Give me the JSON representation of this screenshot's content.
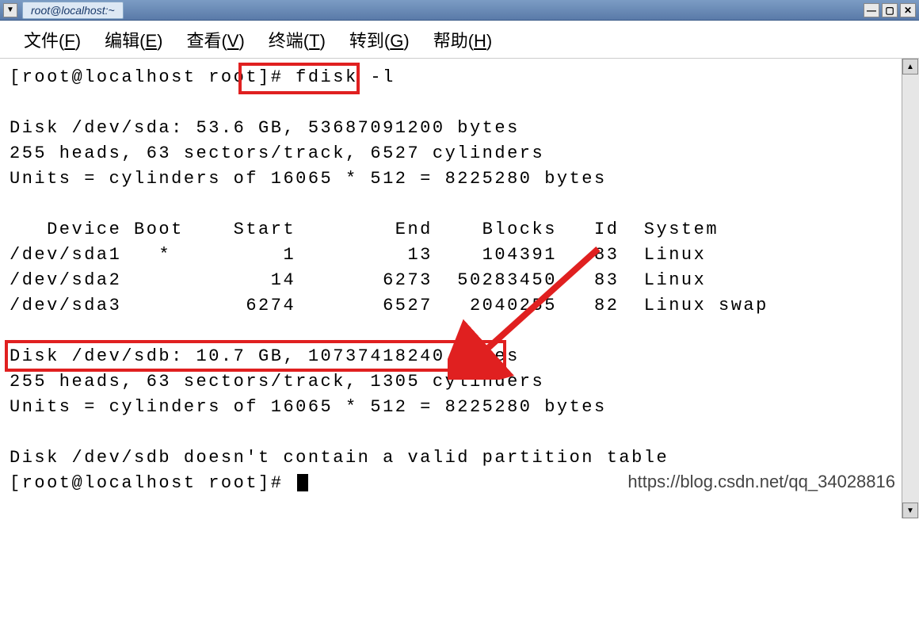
{
  "titlebar": {
    "title": "root@localhost:~"
  },
  "menu": {
    "file": "文件(F)",
    "edit": "编辑(E)",
    "view": "查看(V)",
    "terminal": "终端(T)",
    "go": "转到(G)",
    "help": "帮助(H)"
  },
  "terminal": {
    "prompt_line": "[root@localhost root]# fdisk -l",
    "disk_sda_line": "Disk /dev/sda: 53.6 GB, 53687091200 bytes",
    "sda_heads": "255 heads, 63 sectors/track, 6527 cylinders",
    "sda_units": "Units = cylinders of 16065 * 512 = 8225280 bytes",
    "table_header": "   Device Boot    Start        End    Blocks   Id  System",
    "sda1": "/dev/sda1   *         1         13    104391   83  Linux",
    "sda2": "/dev/sda2            14       6273  50283450   83  Linux",
    "sda3": "/dev/sda3          6274       6527   2040255   82  Linux swap",
    "disk_sdb_line": "Disk /dev/sdb: 10.7 GB, 10737418240 bytes",
    "sdb_heads": "255 heads, 63 sectors/track, 1305 cylinders",
    "sdb_units": "Units = cylinders of 16065 * 512 = 8225280 bytes",
    "sdb_empty": "Disk /dev/sdb doesn't contain a valid partition table",
    "prompt_end": "[root@localhost root]# "
  },
  "watermark": "https://blog.csdn.net/qq_34028816"
}
